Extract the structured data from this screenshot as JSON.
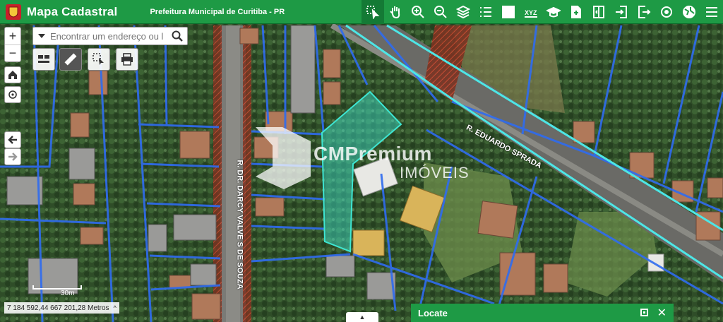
{
  "header": {
    "title": "Mapa Cadastral",
    "subtitle": "Prefeitura Municipal de Curitiba - PR",
    "tools": [
      {
        "icon": "select-parcel-icon",
        "active": true
      },
      {
        "icon": "pan-hand-icon"
      },
      {
        "icon": "zoom-in-icon"
      },
      {
        "icon": "zoom-out-icon"
      },
      {
        "icon": "layers-icon"
      },
      {
        "icon": "legend-list-icon"
      },
      {
        "icon": "grid-icon"
      },
      {
        "icon": "xyz-coordinates-icon",
        "label": "XYZ"
      },
      {
        "icon": "education-cap-icon"
      },
      {
        "icon": "add-document-icon"
      },
      {
        "icon": "compare-icon"
      },
      {
        "icon": "login-icon"
      },
      {
        "icon": "logout-icon"
      },
      {
        "icon": "target-icon"
      },
      {
        "icon": "map-globe-icon"
      },
      {
        "icon": "menu-icon"
      }
    ]
  },
  "search": {
    "placeholder": "Encontrar um endereço ou lo"
  },
  "map": {
    "coordinates": "7 184 592,44 667 201,28 Metros",
    "scale_label": "30m",
    "streets": [
      "R. EDUARDO SPRADA",
      "R. DR. DARCY VALVE S DE SOUZA"
    ],
    "watermark": {
      "line1": "CMPremium",
      "line2": "IMÓVEIS"
    }
  },
  "locate_panel": {
    "title": "Locate"
  },
  "colors": {
    "header": "#1e9a45",
    "parcel_line": "#2f6cf0",
    "selection": "#3ee6d2",
    "road_highlight": "#4de6e6",
    "hatch": "#c43a2a"
  }
}
